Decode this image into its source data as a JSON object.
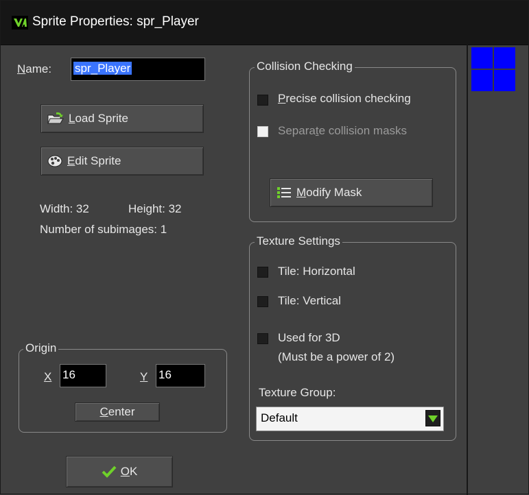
{
  "window": {
    "title": "Sprite Properties: spr_Player"
  },
  "name_field": {
    "label_first": "N",
    "label_rest": "ame:",
    "value": "spr_Player"
  },
  "buttons": {
    "load_first": "L",
    "load_rest": "oad Sprite",
    "edit_first": "E",
    "edit_rest": "dit Sprite",
    "modify_first": "M",
    "modify_rest": "odify Mask",
    "center_first": "C",
    "center_rest": "enter",
    "ok_first": "O",
    "ok_rest": "K"
  },
  "info": {
    "width": "Width: 32",
    "height": "Height: 32",
    "subimages": "Number of subimages: 1"
  },
  "origin": {
    "title": "Origin",
    "x_label": "X",
    "x_value": "16",
    "y_label": "Y",
    "y_value": "16"
  },
  "collision": {
    "title": "Collision Checking",
    "precise_first": "P",
    "precise_rest": "recise collision checking",
    "separate_a": "Separa",
    "separate_u": "t",
    "separate_b": "e collision masks"
  },
  "texture": {
    "title": "Texture Settings",
    "tile_h": "Tile: Horizontal",
    "tile_v": "Tile: Vertical",
    "used_3d": "Used for 3D",
    "used_3d_note": "(Must be a power of 2)",
    "group_label": "Texture Group:",
    "group_value": "Default"
  },
  "colors": {
    "background": "#404040",
    "titlebar": "#161616",
    "selection": "#3a74ff",
    "preview_blue": "#0000ff",
    "logo_green": "#6fd12a"
  }
}
